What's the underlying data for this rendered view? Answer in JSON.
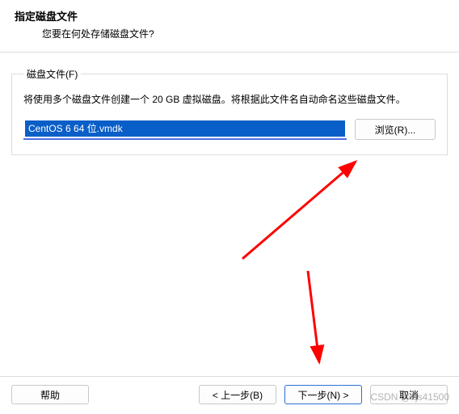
{
  "header": {
    "title": "指定磁盘文件",
    "subtitle": "您要在何处存储磁盘文件?"
  },
  "group": {
    "legend": "磁盘文件(F)",
    "description": "将使用多个磁盘文件创建一个 20 GB 虚拟磁盘。将根据此文件名自动命名这些磁盘文件。",
    "file_value": "CentOS 6 64 位.vmdk",
    "browse_label": "浏览(R)..."
  },
  "buttons": {
    "help": "帮助",
    "back": "< 上一步(B)",
    "next": "下一步(N) >",
    "cancel": "取消"
  },
  "watermark": "CSDN @xjs41500"
}
